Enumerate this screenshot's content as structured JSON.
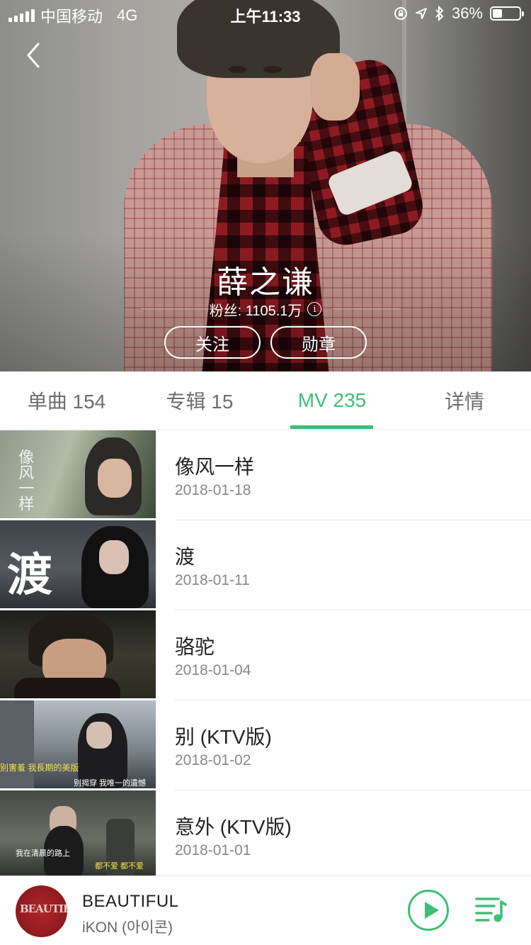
{
  "status_bar": {
    "carrier": "中国移动",
    "network": "4G",
    "time": "上午11:33",
    "battery": "36%",
    "battery_level": 0.36
  },
  "artist": {
    "name": "薛之谦",
    "fans": "粉丝: 1105.1万",
    "follow_label": "关注",
    "badge_label": "勋章"
  },
  "tabs": [
    {
      "label": "单曲 154"
    },
    {
      "label": "专辑 15"
    },
    {
      "label": "MV 235",
      "active": true
    },
    {
      "label": "详情"
    }
  ],
  "mv_list": [
    {
      "title": "像风一样",
      "date": "2018-01-18"
    },
    {
      "title": "渡",
      "date": "2018-01-11"
    },
    {
      "title": "骆驼",
      "date": "2018-01-04"
    },
    {
      "title": "别 (KTV版)",
      "date": "2018-01-02"
    },
    {
      "title": "意外 (KTV版)",
      "date": "2018-01-01"
    }
  ],
  "thumbs": {
    "t1_text": "像风一样",
    "t2_text": "渡",
    "t4_sub1": "别害羞 我長期的美版",
    "t4_sub2": "别揭穿 我唯一的遺憾",
    "t5_sub1": "我在清晨的路上",
    "t5_sub2": "都不爱 都不爱"
  },
  "now_playing": {
    "title": "BEAUTIFUL",
    "artist": "iKON (아이콘)",
    "cover_text": "BEAUTIFUL"
  },
  "colors": {
    "accent": "#3dbf78",
    "text_primary": "#222222",
    "text_secondary": "#888888"
  }
}
